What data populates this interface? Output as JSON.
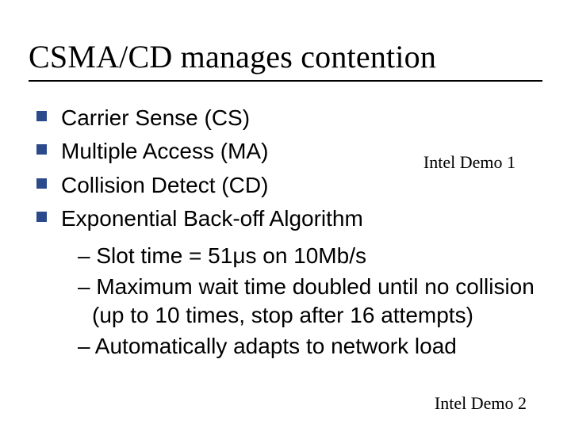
{
  "title": "CSMA/CD manages contention",
  "bullets": [
    "Carrier Sense (CS)",
    "Multiple Access (MA)",
    "Collision Detect (CD)",
    "Exponential Back-off Algorithm"
  ],
  "sub_bullets": [
    "– Slot time = 51μs on 10Mb/s",
    "– Maximum wait time doubled until no collision (up to 10 times, stop after 16 attempts)",
    "– Automatically adapts to network load"
  ],
  "demo1": "Intel Demo 1",
  "demo2": "Intel Demo 2"
}
